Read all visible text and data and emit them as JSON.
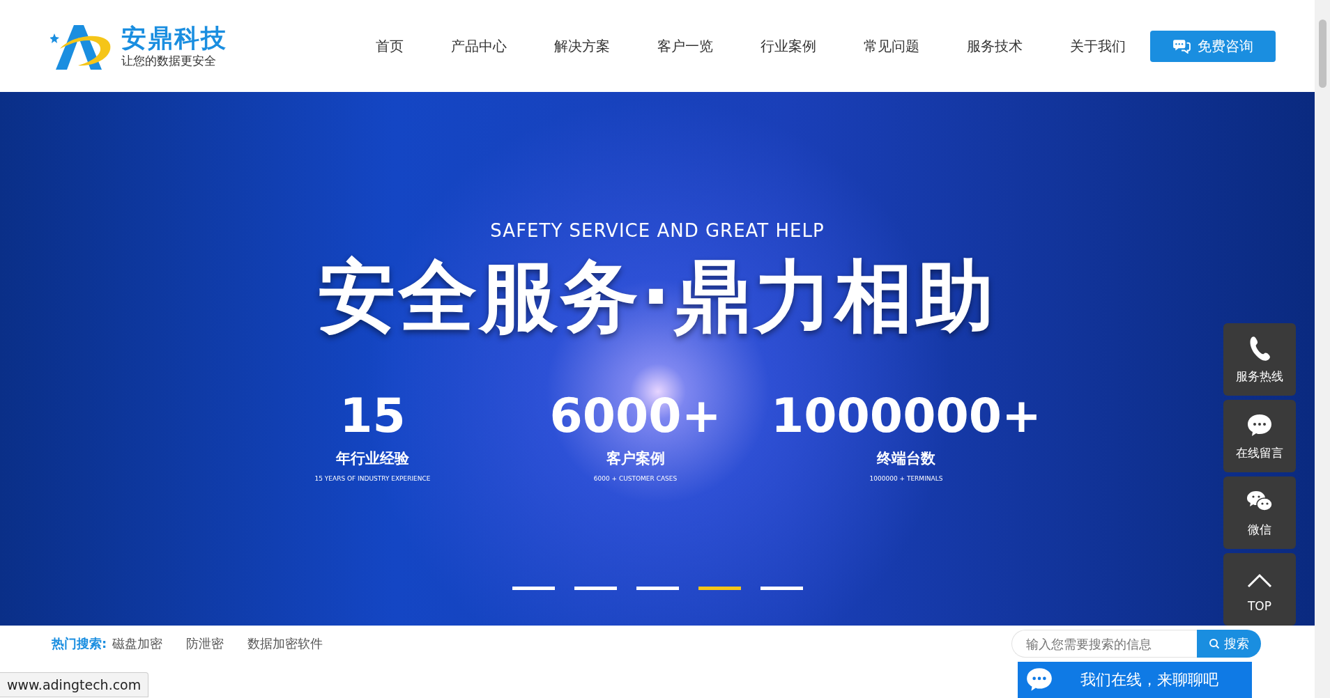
{
  "header": {
    "logo": {
      "name": "安鼎科技",
      "slogan": "让您的数据更安全"
    },
    "nav": [
      {
        "label": "首页",
        "selected": false
      },
      {
        "label": "产品中心",
        "selected": false
      },
      {
        "label": "解决方案",
        "selected": false
      },
      {
        "label": "客户一览",
        "selected": false
      },
      {
        "label": "行业案例",
        "selected": false
      },
      {
        "label": "常见问题",
        "selected": false
      },
      {
        "label": "服务技术",
        "selected": false
      },
      {
        "label": "关于我们",
        "selected": false
      }
    ],
    "consult_button": "免费咨询"
  },
  "banner": {
    "subtitle": "SAFETY SERVICE AND GREAT HELP",
    "title": "安全服务·鼎力相助",
    "stats": [
      {
        "value": "15",
        "label": "年行业经验",
        "caption": "15 YEARS OF INDUSTRY EXPERIENCE"
      },
      {
        "value": "6000+",
        "label": "客户案例",
        "caption": "6000 + CUSTOMER CASES"
      },
      {
        "value": "1000000+",
        "label": "终端台数",
        "caption": "1000000 + TERMINALS"
      }
    ],
    "dots": [
      {
        "selected": false
      },
      {
        "selected": false
      },
      {
        "selected": false
      },
      {
        "selected": true
      },
      {
        "selected": false
      }
    ]
  },
  "hot_search": {
    "label": "热门搜索:",
    "terms": [
      "磁盘加密",
      "防泄密",
      "数据加密软件"
    ],
    "placeholder": "输入您需要搜索的信息",
    "button": "搜索"
  },
  "side_tools": [
    {
      "kind": "phone",
      "label": "服务热线"
    },
    {
      "kind": "message",
      "label": "在线留言"
    },
    {
      "kind": "wechat",
      "label": "微信"
    },
    {
      "kind": "top",
      "label": "TOP"
    }
  ],
  "chat_bar": "我们在线，来聊聊吧",
  "status_url": "www.adingtech.com"
}
